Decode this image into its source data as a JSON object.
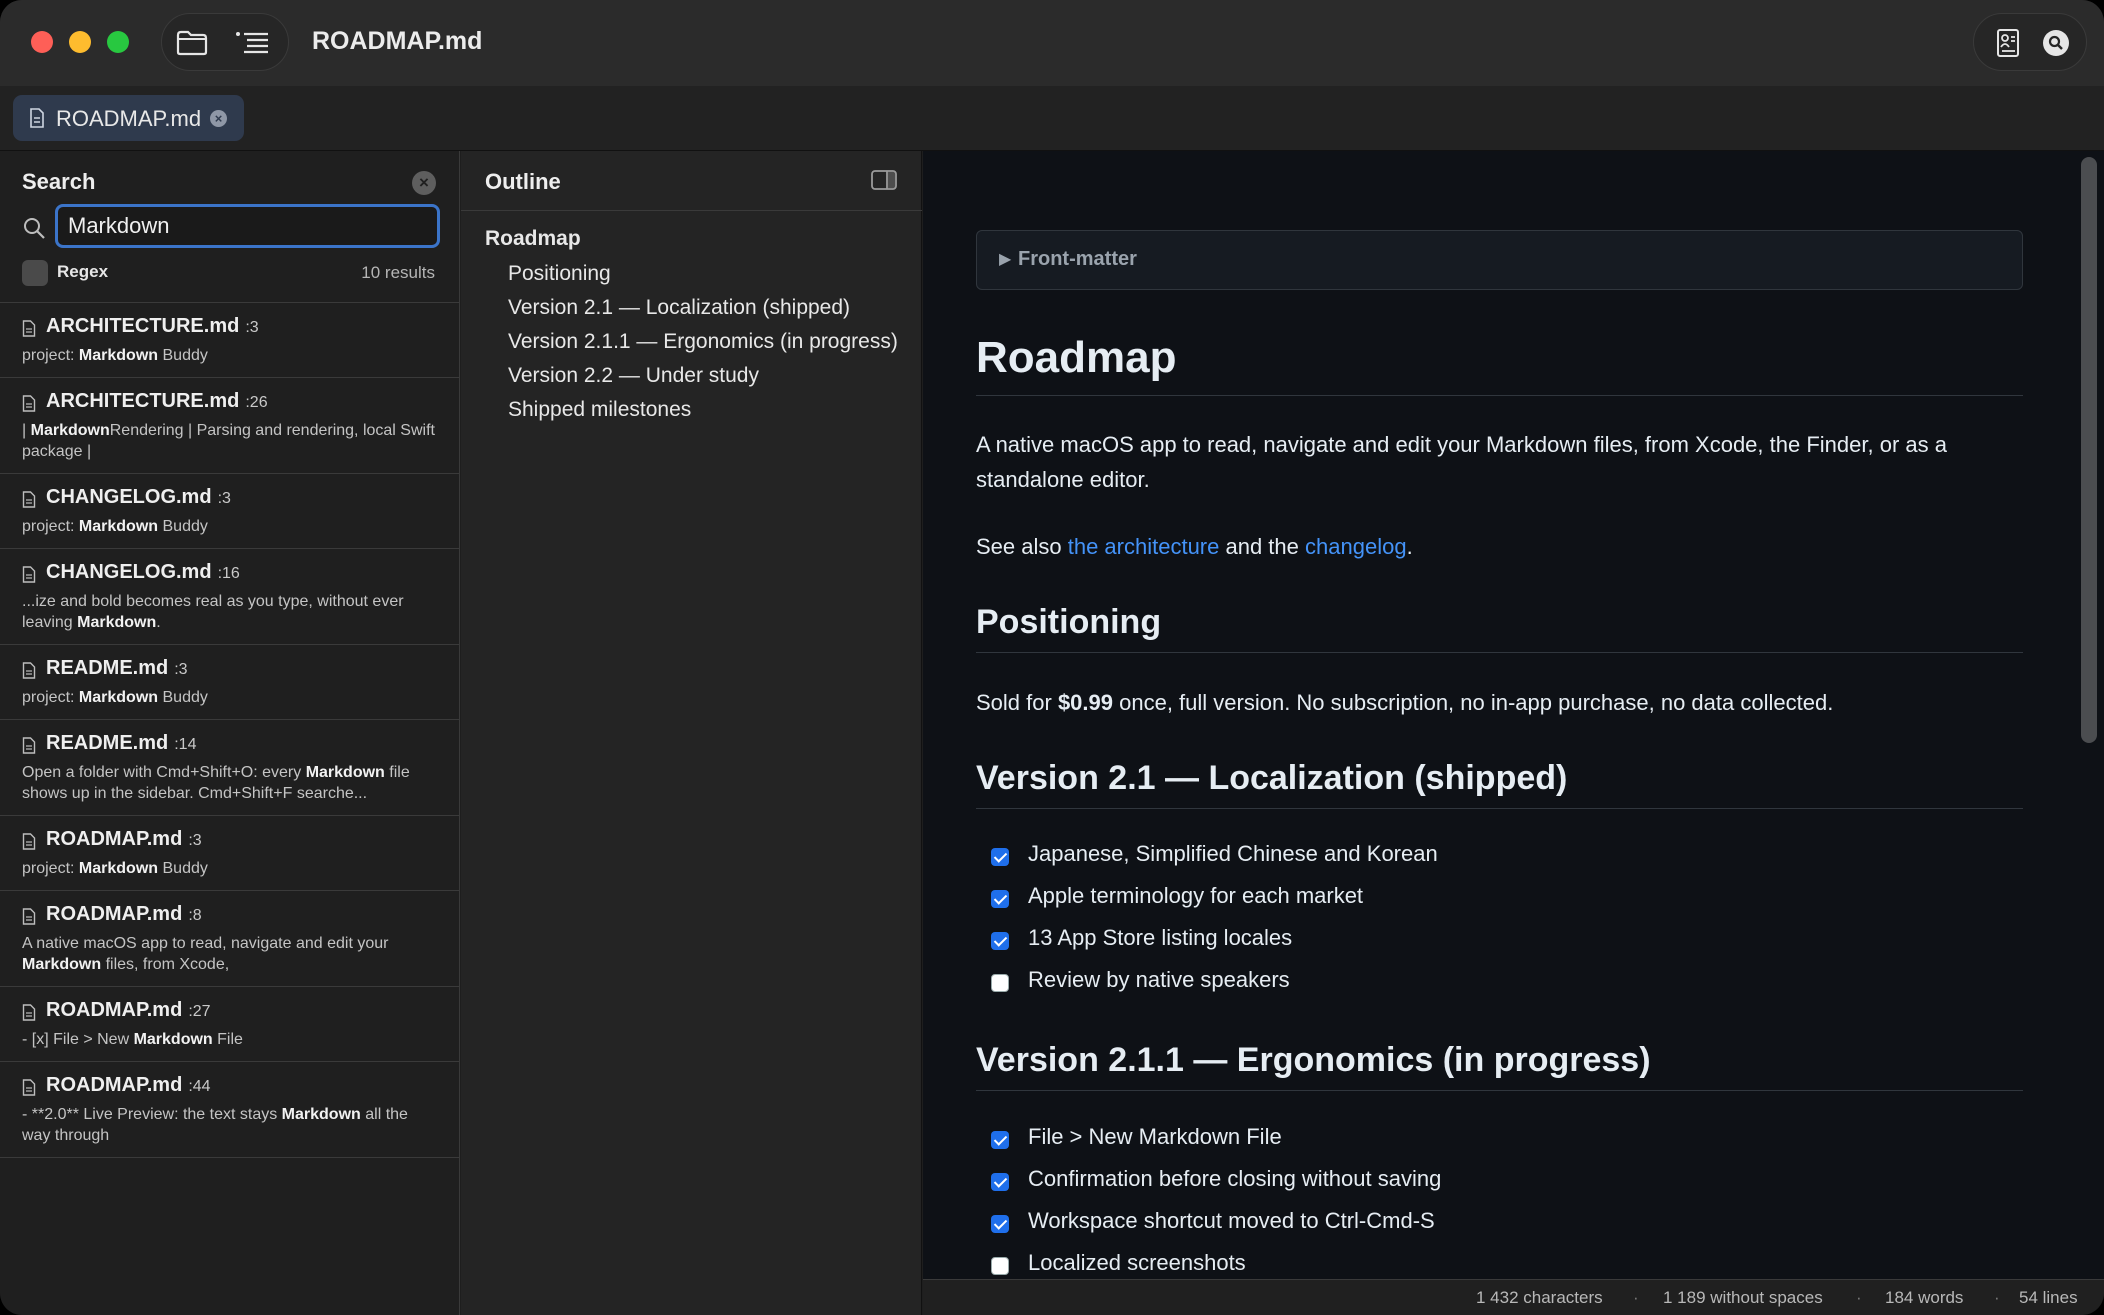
{
  "window": {
    "title": "ROADMAP.md"
  },
  "tab": {
    "label": "ROADMAP.md"
  },
  "search": {
    "title": "Search",
    "query": "Markdown",
    "regex_label": "Regex",
    "results_count": "10 results",
    "results": [
      {
        "file": "ARCHITECTURE.md",
        "line": ":3",
        "snippet": [
          [
            "project: ",
            false
          ],
          [
            "Markdown",
            true
          ],
          [
            " Buddy",
            false
          ]
        ]
      },
      {
        "file": "ARCHITECTURE.md",
        "line": ":26",
        "snippet": [
          [
            "| ",
            false
          ],
          [
            "Markdown",
            true
          ],
          [
            "Rendering | Parsing and rendering, local Swift package |",
            false
          ]
        ]
      },
      {
        "file": "CHANGELOG.md",
        "line": ":3",
        "snippet": [
          [
            "project: ",
            false
          ],
          [
            "Markdown",
            true
          ],
          [
            " Buddy",
            false
          ]
        ]
      },
      {
        "file": "CHANGELOG.md",
        "line": ":16",
        "snippet": [
          [
            "...ize and bold becomes real as you type, without ever leaving ",
            false
          ],
          [
            "Markdown",
            true
          ],
          [
            ".",
            false
          ]
        ]
      },
      {
        "file": "README.md",
        "line": ":3",
        "snippet": [
          [
            "project: ",
            false
          ],
          [
            "Markdown",
            true
          ],
          [
            " Buddy",
            false
          ]
        ]
      },
      {
        "file": "README.md",
        "line": ":14",
        "snippet": [
          [
            "Open a folder with Cmd+Shift+O: every ",
            false
          ],
          [
            "Markdown",
            true
          ],
          [
            " file shows up in the sidebar. Cmd+Shift+F searche...",
            false
          ]
        ]
      },
      {
        "file": "ROADMAP.md",
        "line": ":3",
        "snippet": [
          [
            "project: ",
            false
          ],
          [
            "Markdown",
            true
          ],
          [
            " Buddy",
            false
          ]
        ]
      },
      {
        "file": "ROADMAP.md",
        "line": ":8",
        "snippet": [
          [
            "A native macOS app to read, navigate and edit your ",
            false
          ],
          [
            "Markdown",
            true
          ],
          [
            " files, from Xcode,",
            false
          ]
        ]
      },
      {
        "file": "ROADMAP.md",
        "line": ":27",
        "snippet": [
          [
            "- [x] File > New ",
            false
          ],
          [
            "Markdown",
            true
          ],
          [
            " File",
            false
          ]
        ]
      },
      {
        "file": "ROADMAP.md",
        "line": ":44",
        "snippet": [
          [
            "- **2.0** Live Preview: the text stays ",
            false
          ],
          [
            "Markdown",
            true
          ],
          [
            " all the way through",
            false
          ]
        ]
      }
    ]
  },
  "outline": {
    "title": "Outline",
    "items": [
      {
        "label": "Roadmap",
        "level": 1
      },
      {
        "label": "Positioning",
        "level": 2
      },
      {
        "label": "Version 2.1 — Localization (shipped)",
        "level": 2
      },
      {
        "label": "Version 2.1.1 — Ergonomics (in progress)",
        "level": 2
      },
      {
        "label": "Version 2.2 — Under study",
        "level": 2
      },
      {
        "label": "Shipped milestones",
        "level": 2
      }
    ]
  },
  "document": {
    "frontmatter_label": "Front-matter",
    "h1": "Roadmap",
    "intro": "A native macOS app to read, navigate and edit your Markdown files, from Xcode, the Finder, or as a standalone editor.",
    "see_also": {
      "prefix": "See also ",
      "link1": "the architecture",
      "middle": " and the ",
      "link2": "changelog",
      "suffix": "."
    },
    "positioning": {
      "heading": "Positioning",
      "prefix": "Sold for ",
      "price": "$0.99",
      "suffix": " once, full version. No subscription, no in-app purchase, no data collected."
    },
    "v21": {
      "heading": "Version 2.1 — Localization (shipped)",
      "tasks": [
        {
          "text": "Japanese, Simplified Chinese and Korean",
          "done": true
        },
        {
          "text": "Apple terminology for each market",
          "done": true
        },
        {
          "text": "13 App Store listing locales",
          "done": true
        },
        {
          "text": "Review by native speakers",
          "done": false
        }
      ]
    },
    "v211": {
      "heading": "Version 2.1.1 — Ergonomics (in progress)",
      "tasks": [
        {
          "text": "File > New Markdown File",
          "done": true
        },
        {
          "text": "Confirmation before closing without saving",
          "done": true
        },
        {
          "text": "Workspace shortcut moved to Ctrl-Cmd-S",
          "done": true
        },
        {
          "text": "Localized screenshots",
          "done": false
        }
      ]
    }
  },
  "status": {
    "characters": "1 432 characters",
    "without_spaces": "1 189 without spaces",
    "words": "184 words",
    "lines": "54 lines",
    "separator": "·"
  },
  "icons": {
    "folder": "folder-icon",
    "outline": "list-icon",
    "contact": "contact-card-icon",
    "search": "search-icon",
    "document": "document-icon",
    "sidebar_toggle": "sidebar-toggle-icon"
  },
  "colors": {
    "accent": "#3b74c9",
    "link": "#4493f8",
    "checkbox": "#1f6feb",
    "close": "#fe5f57",
    "minimize": "#febc2e",
    "maximize": "#28c840"
  }
}
